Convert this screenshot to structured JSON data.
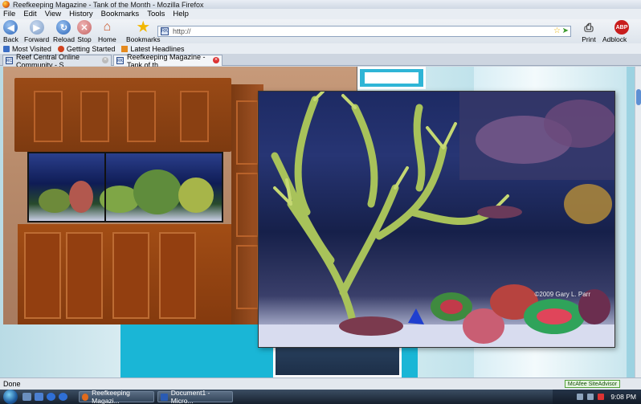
{
  "window": {
    "title": "Reefkeeping Magazine - Tank of the Month - Mozilla Firefox"
  },
  "menu": [
    "File",
    "Edit",
    "View",
    "History",
    "Bookmarks",
    "Tools",
    "Help"
  ],
  "toolbar": {
    "back": "Back",
    "forward": "Forward",
    "reload": "Reload",
    "stop": "Stop",
    "home": "Home",
    "bookmarks": "Bookmarks",
    "print": "Print",
    "adblock": "Adblock Plus",
    "adblock_badge": "ABP"
  },
  "address": {
    "value": "http://"
  },
  "bookmarks_bar": [
    "Most Visited",
    "Getting Started",
    "Latest Headlines"
  ],
  "tabs": [
    {
      "label": "Reef Central Online Community - S...",
      "active": false
    },
    {
      "label": "Reefkeeping Magazine - Tank of th...",
      "active": true
    }
  ],
  "content": {
    "photo_credit": "©2009 Gary L. Parr"
  },
  "status": {
    "text": "Done",
    "mcafee": "McAfee SiteAdvisor"
  },
  "taskbar": {
    "buttons": [
      "Reefkeeping Magazi...",
      "Document1 - Micro..."
    ],
    "clock": "9:08 PM"
  },
  "colors": {
    "accent": "#1ab6d6",
    "cabinet": "#8a4012"
  }
}
